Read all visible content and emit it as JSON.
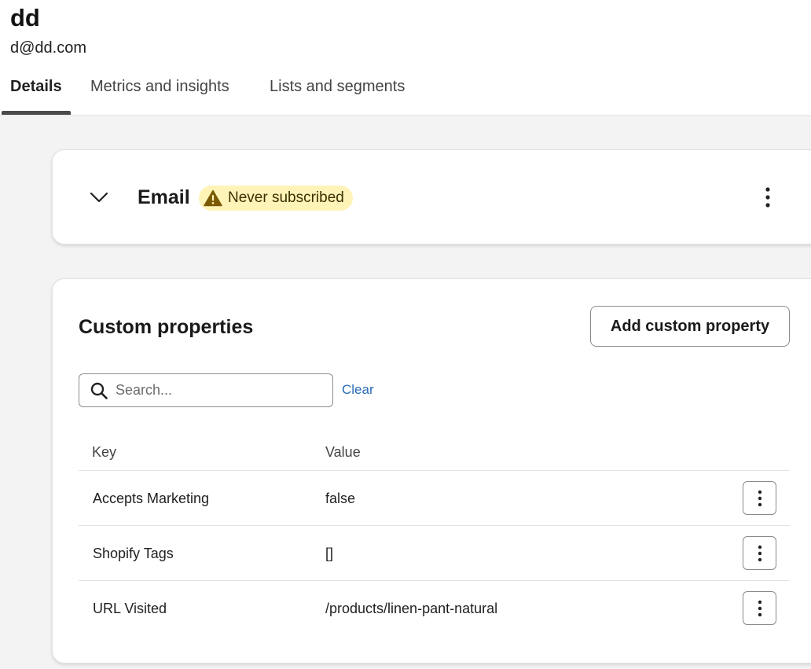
{
  "profile": {
    "name": "dd",
    "email": "d@dd.com"
  },
  "tabs": [
    {
      "label": "Details",
      "active": true
    },
    {
      "label": "Metrics and insights",
      "active": false
    },
    {
      "label": "Lists and segments",
      "active": false
    }
  ],
  "email_channel": {
    "title": "Email",
    "status": "Never subscribed",
    "status_icon": "warning-icon",
    "expand_icon": "chevron-down-icon",
    "menu_icon": "kebab-menu-icon"
  },
  "custom_properties": {
    "title": "Custom properties",
    "add_button_label": "Add custom property",
    "search": {
      "placeholder": "Search...",
      "value": ""
    },
    "clear_label": "Clear",
    "columns": {
      "key": "Key",
      "value": "Value"
    },
    "rows": [
      {
        "key": "Accepts Marketing",
        "value": "false"
      },
      {
        "key": "Shopify Tags",
        "value": "[]"
      },
      {
        "key": "URL Visited",
        "value": "/products/linen-pant-natural"
      }
    ]
  },
  "colors": {
    "badge_background": "#fff3b8",
    "badge_icon": "#7a5a00",
    "link": "#2a6bb8",
    "page_background": "#f3f3f3"
  }
}
